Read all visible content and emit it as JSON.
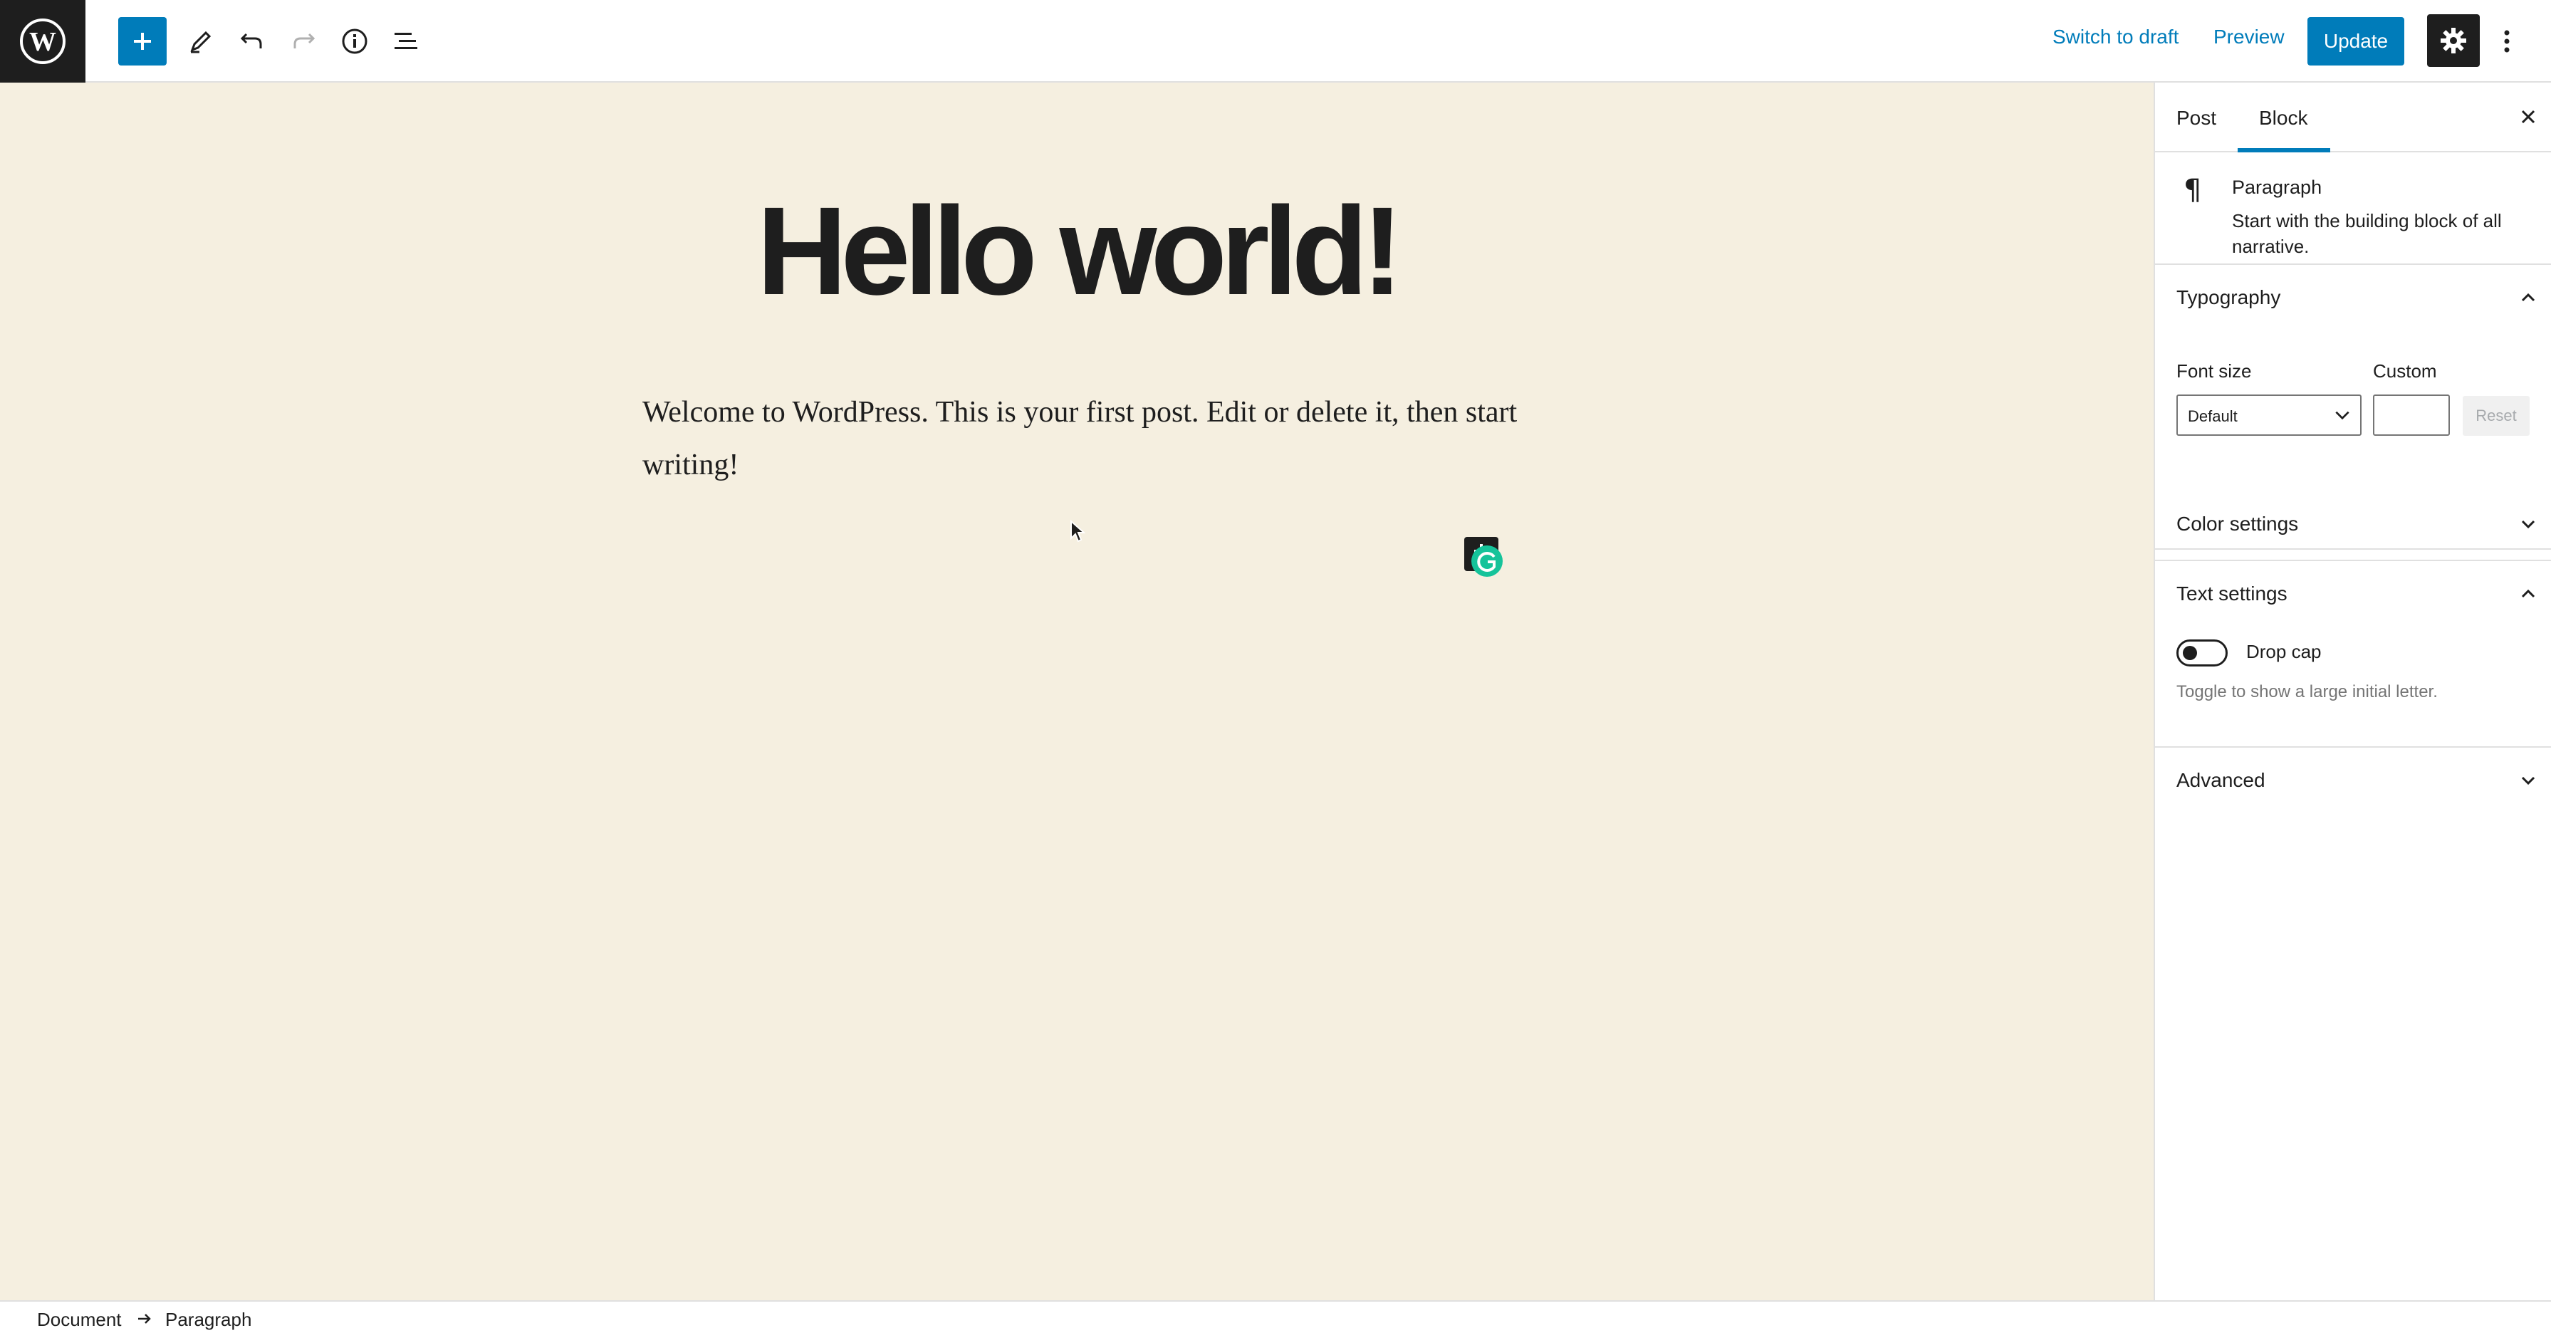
{
  "toolbar": {
    "logo_icon": "wordpress-logo",
    "add_block_icon": "plus-icon",
    "tools_icon": "pencil-icon",
    "undo_icon": "undo-icon",
    "redo_icon": "redo-icon",
    "details_icon": "info-icon",
    "list_view_icon": "list-view-icon",
    "switch_to_draft": "Switch to draft",
    "preview": "Preview",
    "update": "Update",
    "settings_icon": "gear-icon",
    "more_icon": "more-vertical-icon"
  },
  "editor": {
    "title": "Hello world!",
    "paragraph": "Welcome to WordPress. This is your first post. Edit or delete it, then start writing!"
  },
  "sidebar": {
    "tabs": [
      {
        "label": "Post",
        "active": false
      },
      {
        "label": "Block",
        "active": true
      }
    ],
    "block": {
      "icon": "¶",
      "name": "Paragraph",
      "description": "Start with the building block of all narrative."
    },
    "typography": {
      "title": "Typography",
      "expanded": true,
      "font_size_label": "Font size",
      "custom_label": "Custom",
      "font_size_value": "Default",
      "custom_value": "",
      "reset_label": "Reset"
    },
    "color_settings": {
      "title": "Color settings",
      "expanded": false
    },
    "text_settings": {
      "title": "Text settings",
      "expanded": true,
      "drop_cap_label": "Drop cap",
      "drop_cap_on": false,
      "help": "Toggle to show a large initial letter."
    },
    "advanced": {
      "title": "Advanced",
      "expanded": false
    }
  },
  "footer": {
    "breadcrumb": [
      "Document",
      "Paragraph"
    ]
  },
  "colors": {
    "accent": "#007cba",
    "canvas_bg": "#f5efe0",
    "dark": "#1e1e1e",
    "grammarly": "#15c39a"
  }
}
